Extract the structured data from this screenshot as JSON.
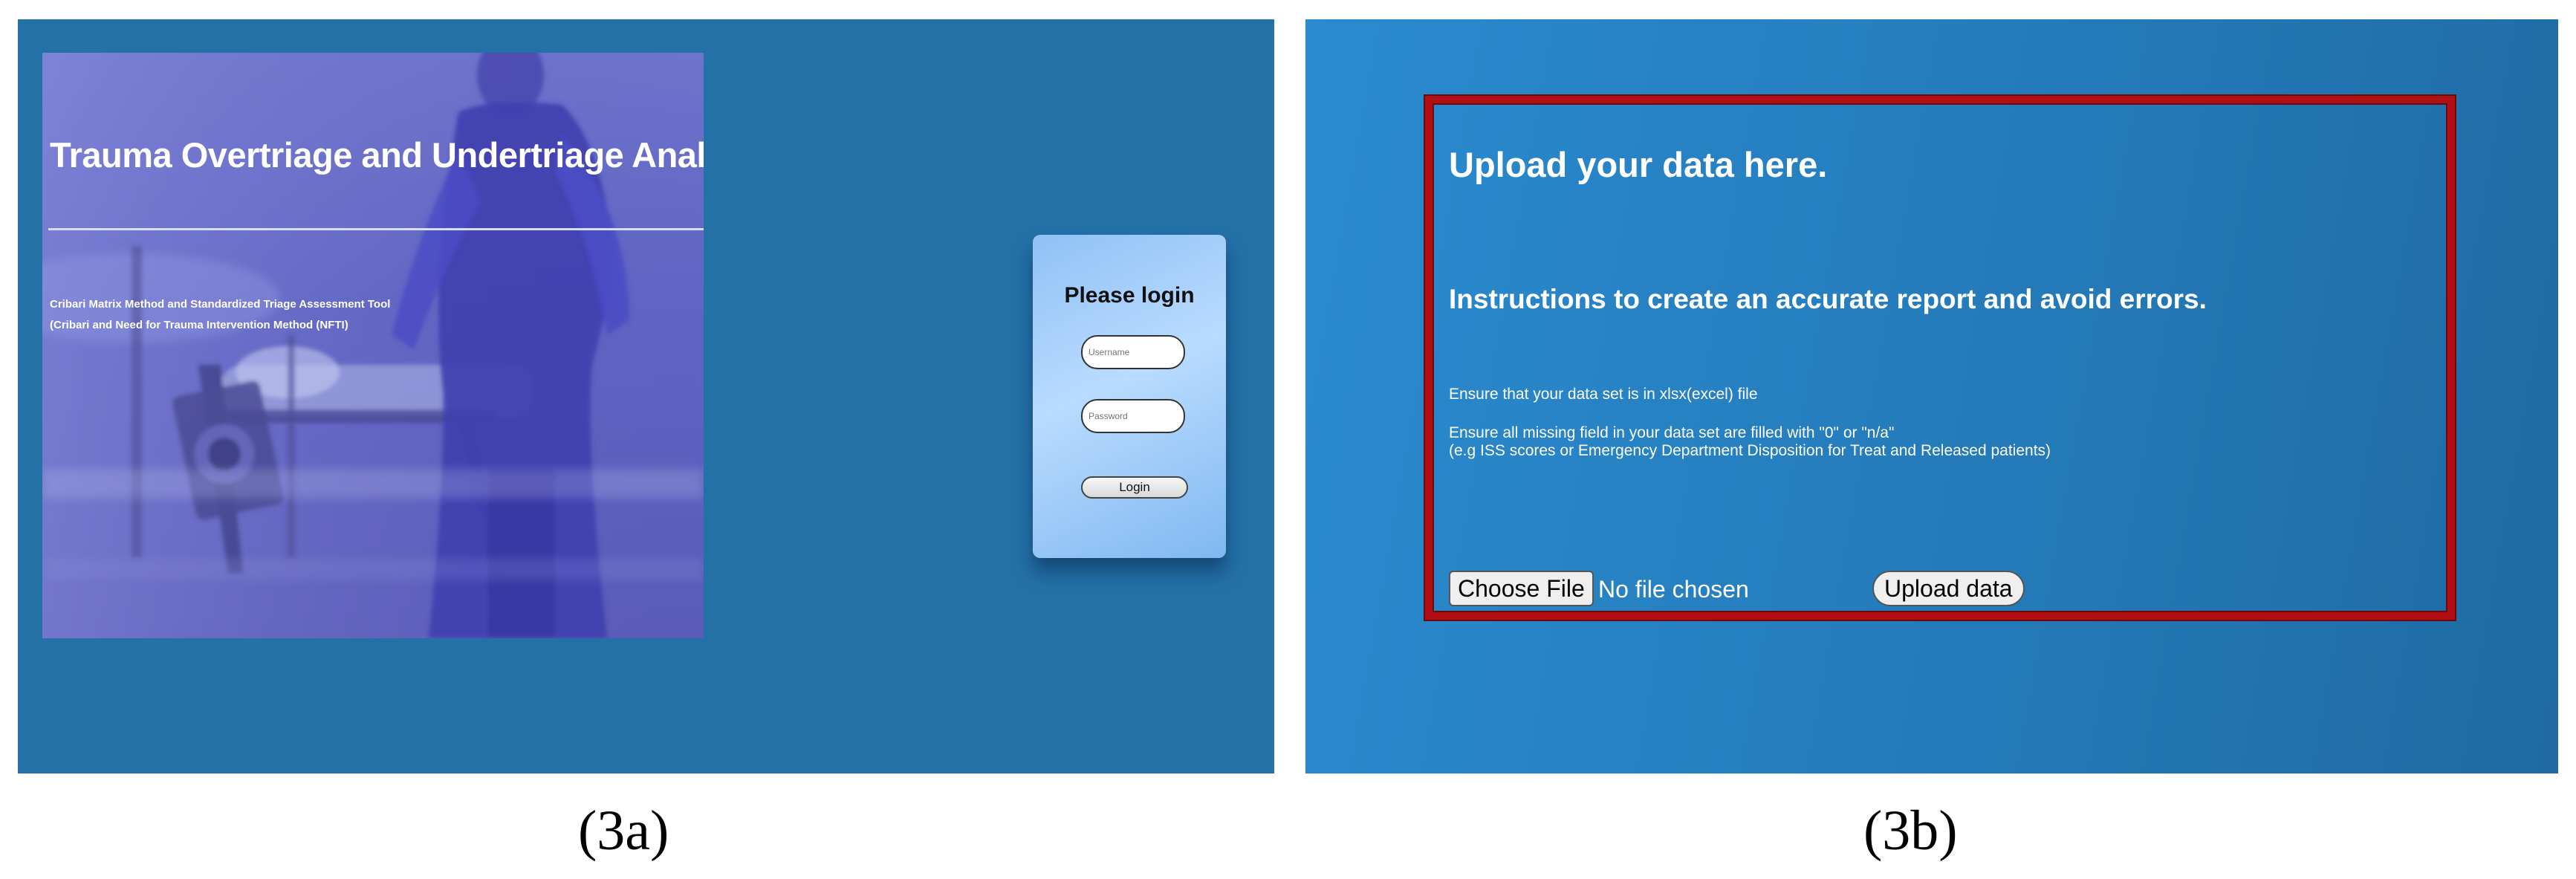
{
  "login_screen": {
    "hero": {
      "title": "Trauma Overtriage and Undertriage Analysis Tool",
      "subtitle_line1": "Cribari Matrix Method and Standardized Triage Assessment Tool",
      "subtitle_line2": "(Cribari and Need for Trauma Intervention Method (NFTI)"
    },
    "login": {
      "heading": "Please login",
      "username_placeholder": "Username",
      "password_placeholder": "Password",
      "button_label": "Login"
    },
    "caption": "(3a)"
  },
  "upload_screen": {
    "heading": "Upload your data here.",
    "instructions_heading": "Instructions to create an accurate report and avoid errors.",
    "instructions": [
      "Ensure that your data set is in xlsx(excel) file",
      "Ensure all missing field in your data set are filled with \"0\" or \"n/a\"",
      "(e.g ISS scores or Emergency Department Disposition for Treat and Released patients)"
    ],
    "choose_file_label": "Choose File",
    "file_status": "No file chosen",
    "upload_button_label": "Upload data",
    "caption": "(3b)"
  },
  "colors": {
    "panel_background": "#2471a8",
    "upload_border": "#b10f13",
    "hero_overlay": "#5f63c2",
    "login_box": "#b9dbff"
  }
}
